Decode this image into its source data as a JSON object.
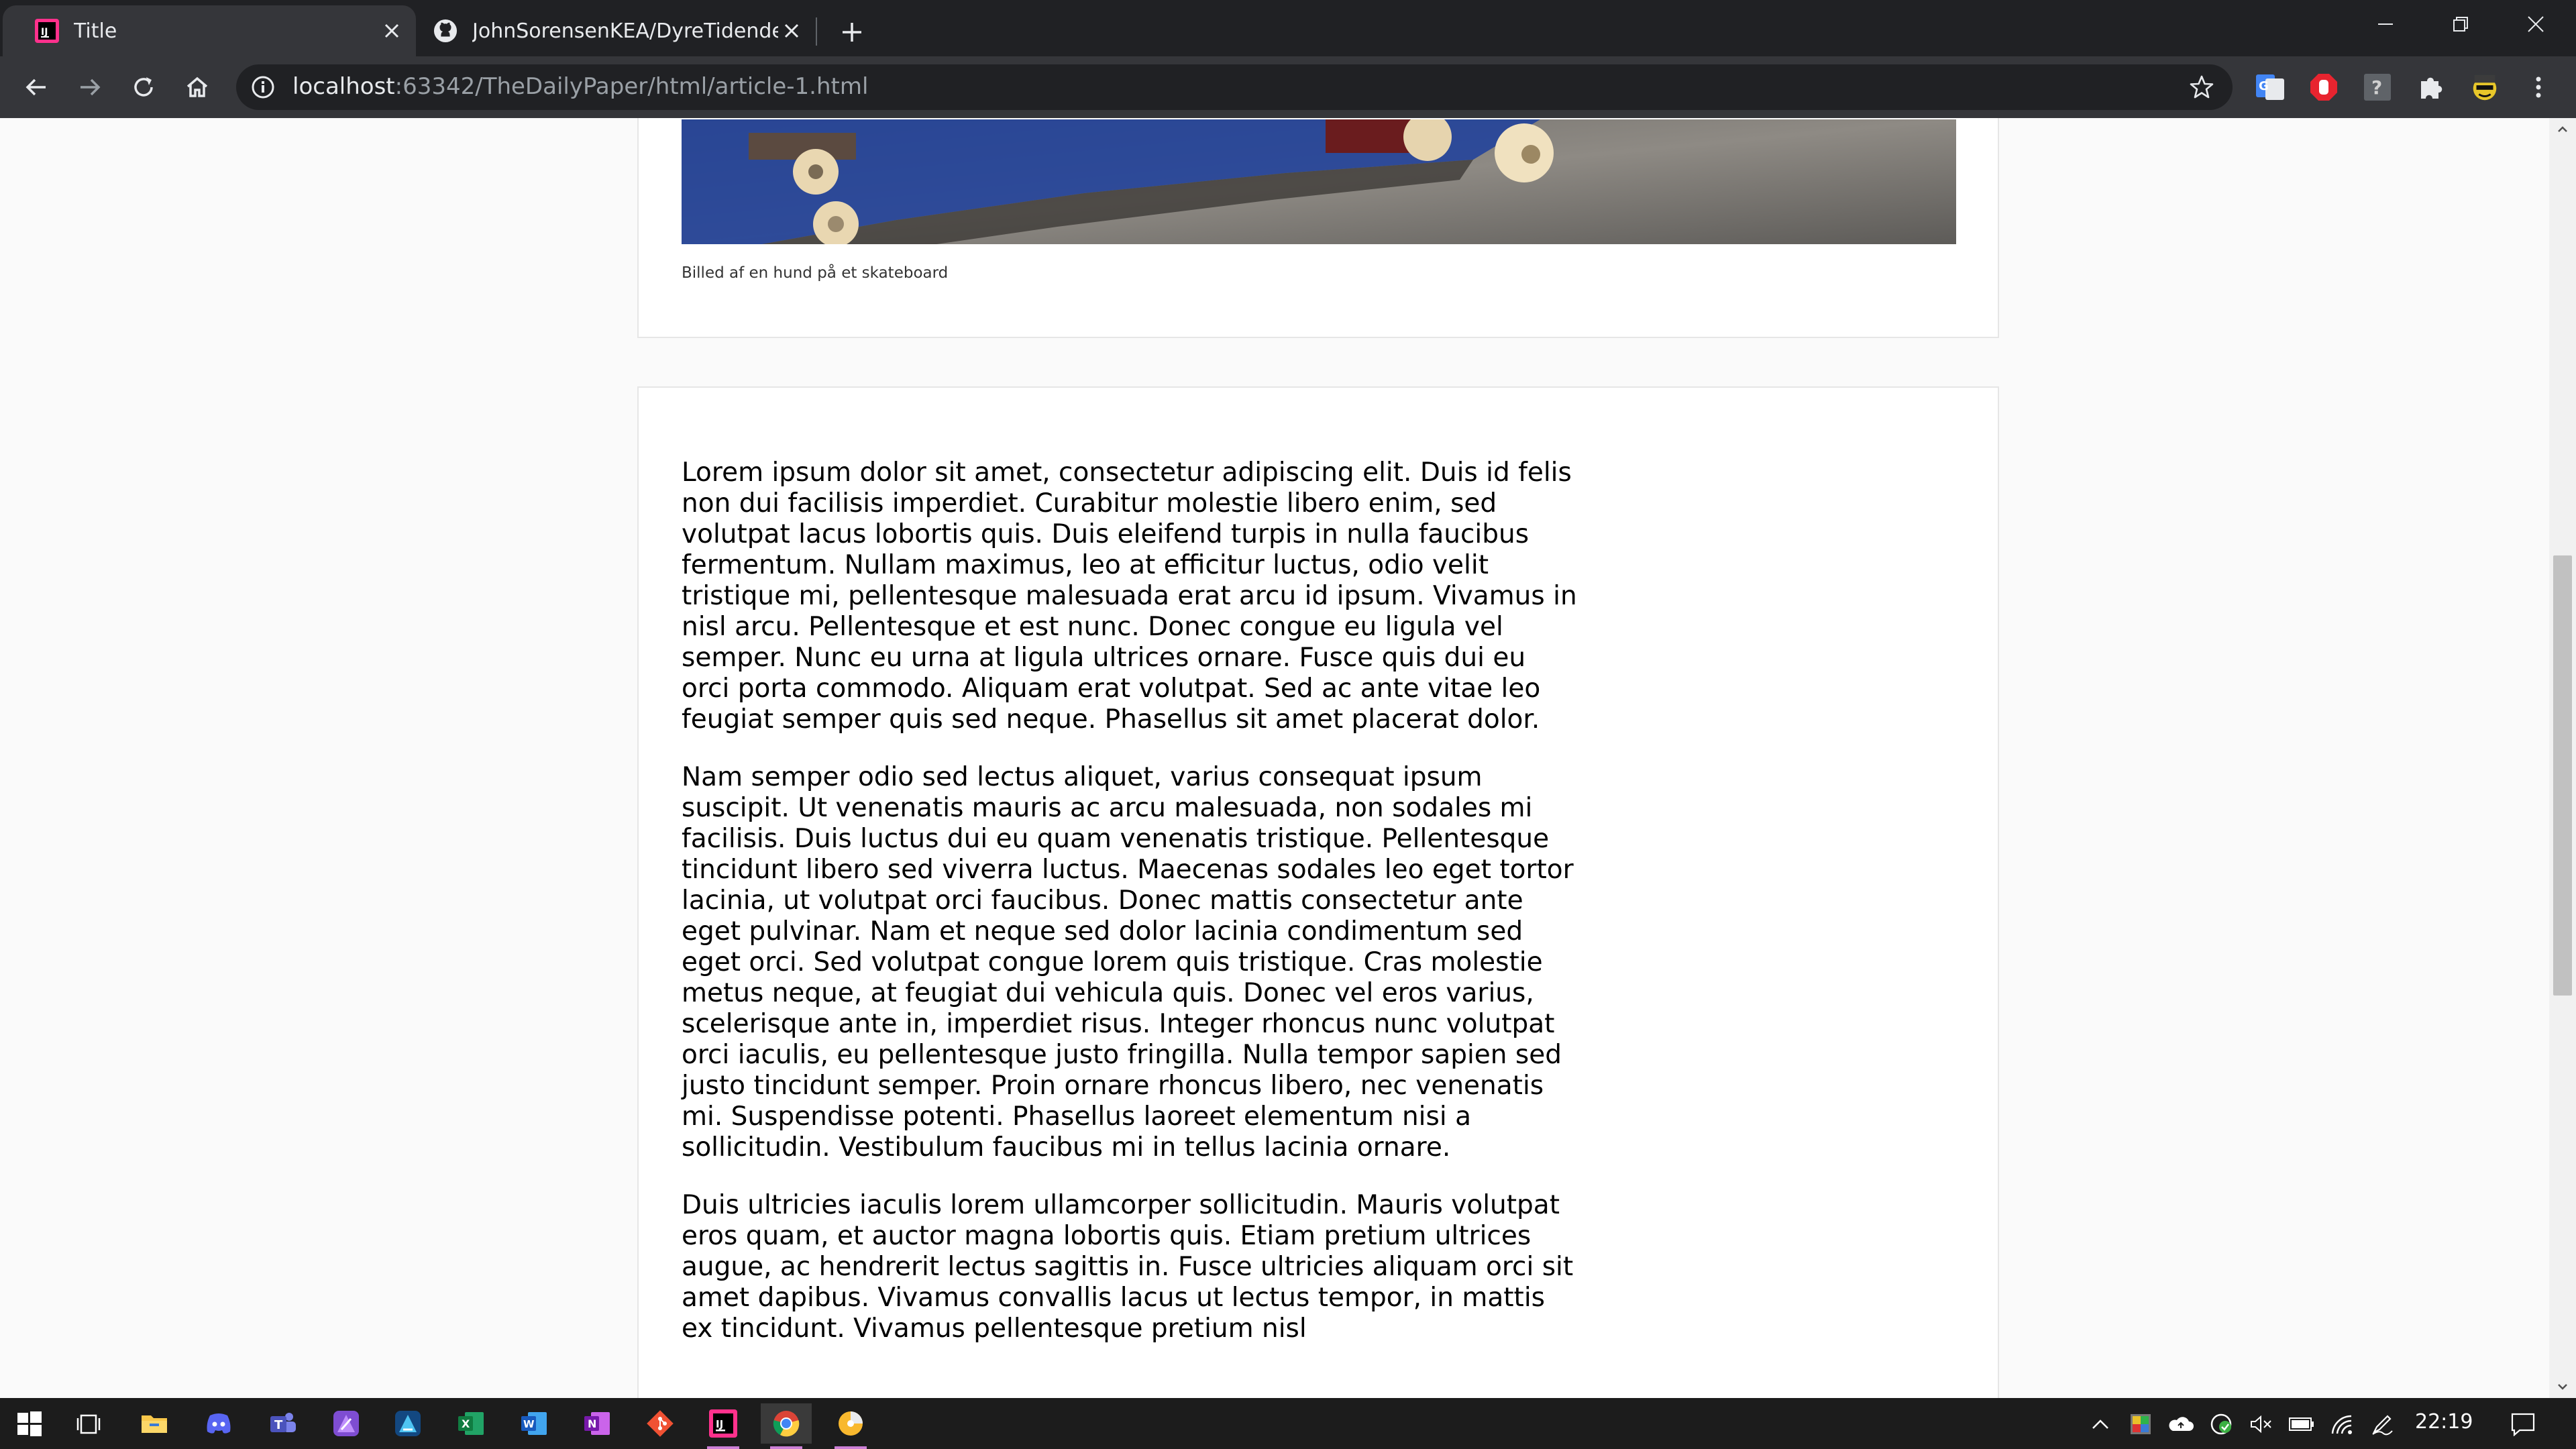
{
  "browser": {
    "tabs": [
      {
        "title": "Title",
        "icon": "intellij-icon",
        "active": true
      },
      {
        "title": "JohnSorensenKEA/DyreTidende",
        "icon": "github-icon",
        "active": false
      }
    ],
    "new_tab_icon": "plus-icon",
    "window_controls": [
      "minimize-icon",
      "restore-icon",
      "close-icon"
    ],
    "address": {
      "host": "localhost",
      "rest": ":63342/TheDailyPaper/html/article-1.html"
    },
    "nav_icons": [
      "back-icon",
      "forward-icon",
      "reload-icon",
      "home-icon"
    ],
    "extensions": [
      "google-translate-icon",
      "adblock-icon",
      "unknown-extension-icon",
      "puzzle-icon",
      "profile-avatar-icon",
      "more-icon"
    ]
  },
  "page": {
    "image_caption": "Billed af en hund på et skateboard",
    "paragraphs": [
      "Lorem ipsum dolor sit amet, consectetur adipiscing elit. Duis id felis non dui facilisis imperdiet. Curabitur molestie libero enim, sed volutpat lacus lobortis quis. Duis eleifend turpis in nulla faucibus fermentum. Nullam maximus, leo at efficitur luctus, odio velit tristique mi, pellentesque malesuada erat arcu id ipsum. Vivamus in nisl arcu. Pellentesque et est nunc. Donec congue eu ligula vel semper. Nunc eu urna at ligula ultrices ornare. Fusce quis dui eu orci porta commodo. Aliquam erat volutpat. Sed ac ante vitae leo feugiat semper quis sed neque. Phasellus sit amet placerat dolor.",
      "Nam semper odio sed lectus aliquet, varius consequat ipsum suscipit. Ut venenatis mauris ac arcu malesuada, non sodales mi facilisis. Duis luctus dui eu quam venenatis tristique. Pellentesque tincidunt libero sed viverra luctus. Maecenas sodales leo eget tortor lacinia, ut volutpat orci faucibus. Donec mattis consectetur ante eget pulvinar. Nam et neque sed dolor lacinia condimentum sed eget orci. Sed volutpat congue lorem quis tristique. Cras molestie metus neque, at feugiat dui vehicula quis. Donec vel eros varius, scelerisque ante in, imperdiet risus. Integer rhoncus nunc volutpat orci iaculis, eu pellentesque justo fringilla. Nulla tempor sapien sed justo tincidunt semper. Proin ornare rhoncus libero, nec venenatis mi. Suspendisse potenti. Phasellus laoreet elementum nisi a sollicitudin. Vestibulum faucibus mi in tellus lacinia ornare.",
      "Duis ultricies iaculis lorem ullamcorper sollicitudin. Mauris volutpat eros quam, et auctor magna lobortis quis. Etiam pretium ultrices augue, ac hendrerit lectus sagittis in. Fusce ultricies aliquam orci sit amet dapibus. Vivamus convallis lacus ut lectus tempor, in mattis ex tincidunt. Vivamus pellentesque pretium nisl"
    ]
  },
  "taskbar": {
    "apps": [
      "windows-start-icon",
      "task-view-icon",
      "file-explorer-icon",
      "discord-icon",
      "teams-icon",
      "affinity-photo-icon",
      "affinity-designer-icon",
      "excel-icon",
      "word-icon",
      "onenote-icon",
      "git-icon",
      "intellij-icon",
      "chrome-icon",
      "clock-app-icon"
    ],
    "tray": [
      "chevron-up-icon",
      "color-picker-icon",
      "onedrive-icon",
      "sync-check-icon",
      "volume-muted-icon",
      "battery-icon",
      "wifi-icon",
      "pen-icon",
      "notification-icon"
    ],
    "time": "22:19"
  },
  "colors": {
    "chrome_dark": "#202124",
    "toolbar": "#35363a",
    "page_bg": "#fafafa",
    "taskbar": "#1c1c1c"
  }
}
